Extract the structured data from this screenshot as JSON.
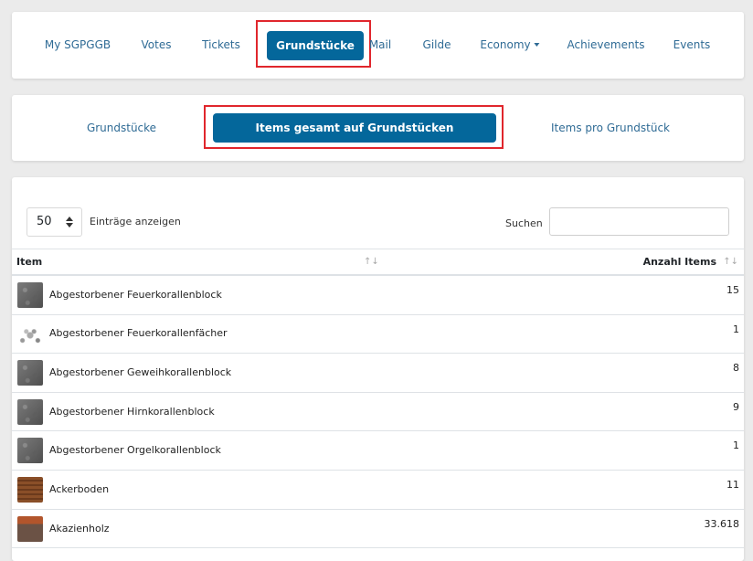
{
  "main_nav": {
    "items": [
      {
        "label": "My SGPGGB"
      },
      {
        "label": "Votes"
      },
      {
        "label": "Tickets"
      },
      {
        "label": "Grundstücke",
        "active": true
      },
      {
        "label": "Mail"
      },
      {
        "label": "Gilde"
      },
      {
        "label": "Economy",
        "dropdown": true
      },
      {
        "label": "Achievements"
      },
      {
        "label": "Events"
      }
    ]
  },
  "sub_nav": {
    "items": [
      {
        "label": "Grundstücke"
      },
      {
        "label": "Items gesamt auf Grundstücken",
        "active": true
      },
      {
        "label": "Items pro Grundstück"
      }
    ]
  },
  "table_controls": {
    "length_value": "50",
    "length_label": "Einträge anzeigen",
    "search_label": "Suchen",
    "search_value": ""
  },
  "table": {
    "columns": [
      {
        "label": "Item",
        "sort": "↑↓"
      },
      {
        "label": "Anzahl Items",
        "sort": "↑↓"
      }
    ],
    "rows": [
      {
        "item": "Abgestorbener Feuerkorallenblock",
        "count": "15",
        "icon": "dead-fire-coral-block-icon"
      },
      {
        "item": "Abgestorbener Feuerkorallenfächer",
        "count": "1",
        "icon": "dead-fire-coral-fan-icon"
      },
      {
        "item": "Abgestorbener Geweihkorallenblock",
        "count": "8",
        "icon": "dead-horn-coral-block-icon"
      },
      {
        "item": "Abgestorbener Hirnkorallenblock",
        "count": "9",
        "icon": "dead-brain-coral-block-icon"
      },
      {
        "item": "Abgestorbener Orgelkorallenblock",
        "count": "1",
        "icon": "dead-tube-coral-block-icon"
      },
      {
        "item": "Ackerboden",
        "count": "11",
        "icon": "farmland-icon"
      },
      {
        "item": "Akazienholz",
        "count": "33.618",
        "icon": "acacia-wood-icon"
      }
    ]
  },
  "colors": {
    "accent": "#04679b",
    "link": "#2f6b95",
    "highlight_border": "#e0262c",
    "background": "#ebebeb"
  }
}
